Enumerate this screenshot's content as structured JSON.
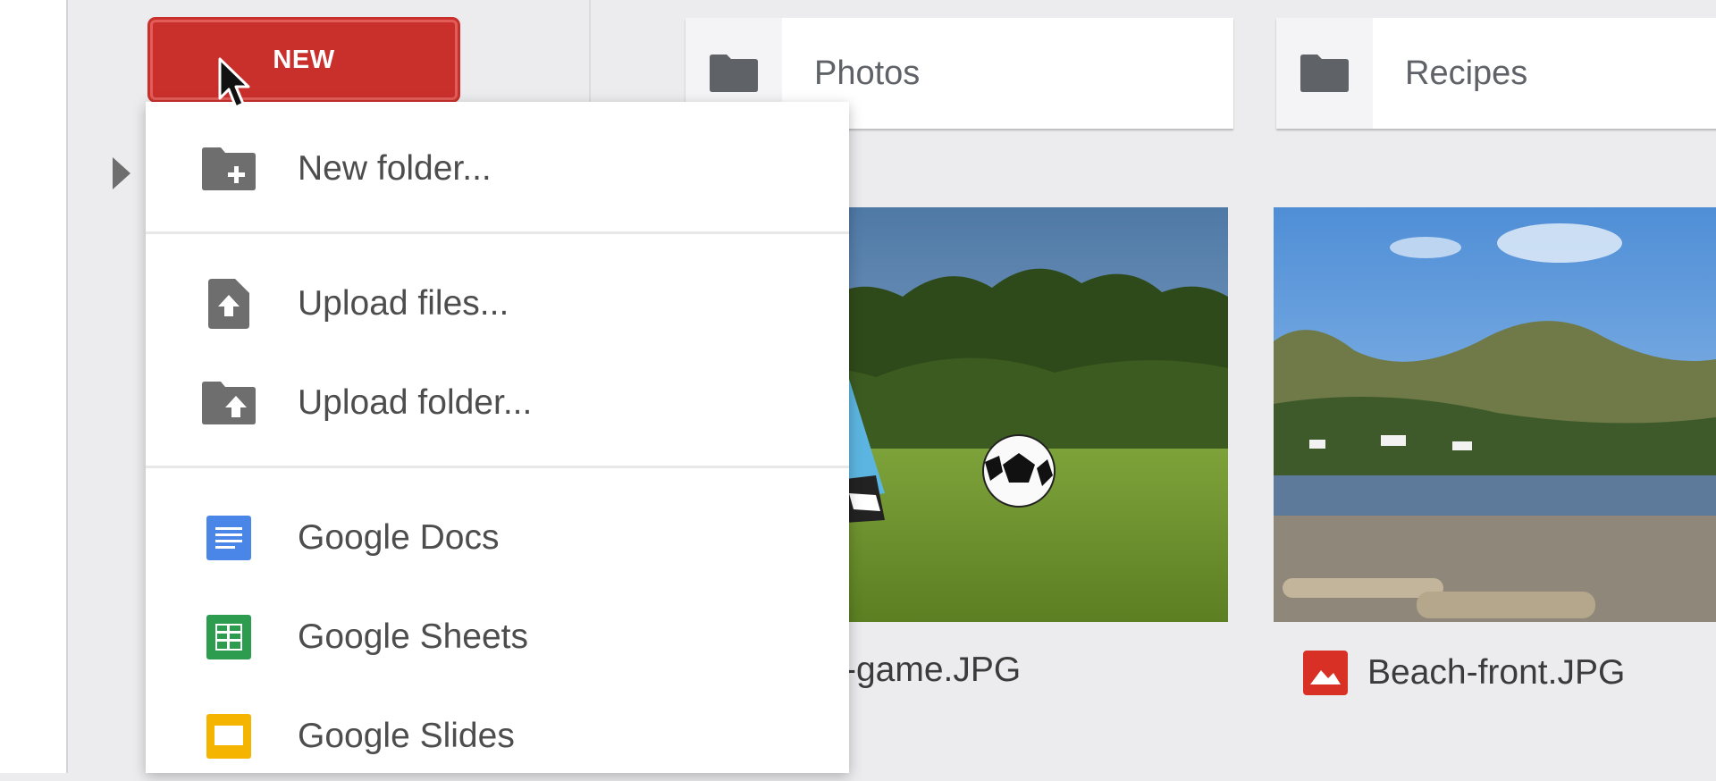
{
  "toolbar": {
    "new_label": "NEW"
  },
  "folders": [
    {
      "name": "Photos"
    },
    {
      "name": "Recipes"
    }
  ],
  "files": [
    {
      "name": "-game.JPG"
    },
    {
      "name": "Beach-front.JPG"
    }
  ],
  "menu": {
    "items": [
      {
        "label": "New folder...",
        "icon": "new-folder-icon"
      },
      {
        "label": "Upload files...",
        "icon": "upload-file-icon"
      },
      {
        "label": "Upload folder...",
        "icon": "upload-folder-icon"
      },
      {
        "label": "Google Docs",
        "icon": "google-docs-icon"
      },
      {
        "label": "Google Sheets",
        "icon": "google-sheets-icon"
      },
      {
        "label": "Google Slides",
        "icon": "google-slides-icon"
      }
    ]
  },
  "colors": {
    "new_button": "#c9302c",
    "docs": "#4a86e8",
    "sheets": "#2e9c4f",
    "slides": "#f4b400",
    "image_file": "#d93025"
  }
}
